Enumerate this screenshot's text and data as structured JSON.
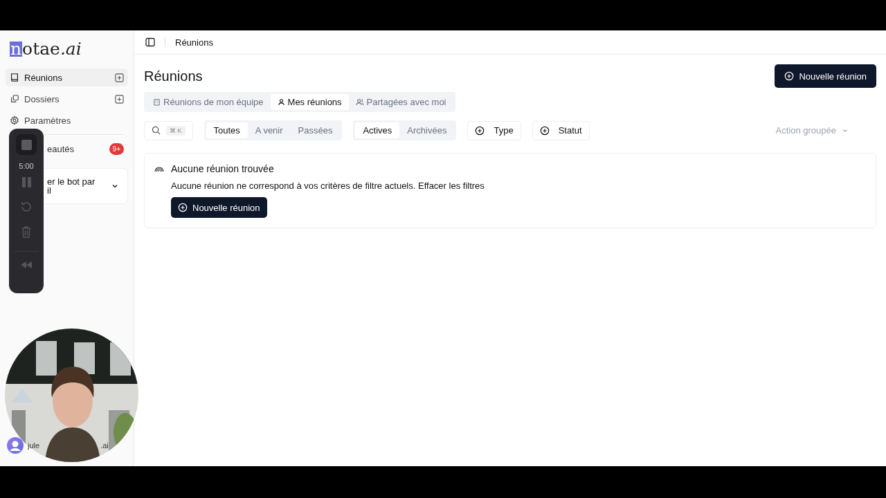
{
  "logo": {
    "highlight": "n",
    "rest": "otae",
    "suffix": ".ai"
  },
  "sidebar": {
    "items": [
      {
        "label": "Réunions",
        "selected": true,
        "add": true
      },
      {
        "label": "Dossiers",
        "selected": false,
        "add": true
      },
      {
        "label": "Paramètres",
        "selected": false,
        "add": false
      }
    ],
    "news": {
      "label": "eautés",
      "badge": "9+"
    },
    "bot_card": {
      "lines": [
        "er le bot par",
        "il"
      ]
    },
    "user": {
      "email_parts": [
        "jule",
        ".ai"
      ]
    }
  },
  "recorder": {
    "time": "5:00"
  },
  "webcam": {
    "kind": "picture"
  },
  "header": {
    "breadcrumb": "Réunions"
  },
  "page": {
    "title": "Réunions",
    "new_button": "Nouvelle réunion"
  },
  "scope_tabs": [
    {
      "label": "Réunions de mon équipe",
      "selected": false
    },
    {
      "label": "Mes réunions",
      "selected": true
    },
    {
      "label": "Partagées avec moi",
      "selected": false
    }
  ],
  "search": {
    "shortcut": "⌘ K"
  },
  "time_filter": [
    {
      "label": "Toutes",
      "selected": true
    },
    {
      "label": "A venir",
      "selected": false
    },
    {
      "label": "Passées",
      "selected": false
    }
  ],
  "state_filter": [
    {
      "label": "Actives",
      "selected": true
    },
    {
      "label": "Archivées",
      "selected": false
    }
  ],
  "filters": [
    "Type",
    "Statut"
  ],
  "bulk_action": {
    "label": "Action groupée",
    "disabled": true
  },
  "empty_state": {
    "title": "Aucune réunion trouvée",
    "message": "Aucune réunion ne correspond à vos critères de filtre actuels. Effacer les filtres",
    "button": "Nouvelle réunion"
  }
}
